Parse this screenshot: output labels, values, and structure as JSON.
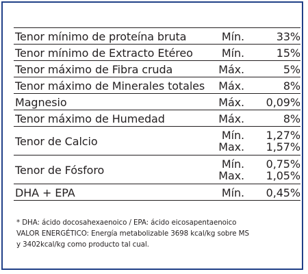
{
  "rows": [
    {
      "name": "Tenor mínimo de proteína bruta",
      "qualifier": "Mín.",
      "value": "33%"
    },
    {
      "name": "Tenor mínimo de Extracto Etéreo",
      "qualifier": "Mín.",
      "value": "15%"
    },
    {
      "name": "Tenor máximo de Fibra cruda",
      "qualifier": "Máx.",
      "value": "5%"
    },
    {
      "name": "Tenor máximo de Minerales totales",
      "qualifier": "Máx.",
      "value": "8%"
    },
    {
      "name": "Magnesio",
      "qualifier": "Máx.",
      "value": "0,09%"
    },
    {
      "name": "Tenor máximo de Humedad",
      "qualifier": "Máx.",
      "value": "8%"
    },
    {
      "name": "Tenor de Calcio",
      "qualifier_min": "Mín.",
      "value_min": "1,27%",
      "qualifier_max": "Max.",
      "value_max": "1,57%"
    },
    {
      "name": "Tenor de Fósforo",
      "qualifier_min": "Mín.",
      "value_min": "0,75%",
      "qualifier_max": "Max.",
      "value_max": "1,05%"
    },
    {
      "name": "DHA + EPA",
      "qualifier": "Mín.",
      "value": "0,45%"
    }
  ],
  "notes": {
    "line1": "* DHA:  ácido docosahexaenoico / EPA: ácido eicosapentaenoico",
    "line2": "VALOR ENERGÉTICO: Energía metabolizable  3698 kcal/kg sobre MS",
    "line3": "y 3402kcal/kg como producto tal cual."
  },
  "colors": {
    "border": "#1f3f87",
    "text": "#231f20"
  }
}
